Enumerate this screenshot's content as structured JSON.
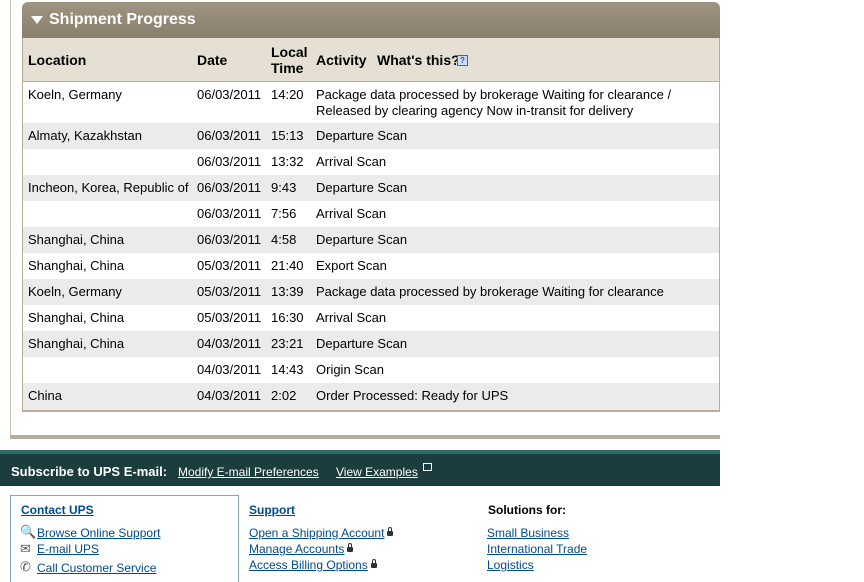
{
  "progress": {
    "title": "Shipment Progress",
    "columns": {
      "location": "Location",
      "date": "Date",
      "local": "Local",
      "time": "Time",
      "activity": "Activity",
      "whats_this": "What's this?"
    },
    "rows": [
      {
        "location": "Koeln, Germany",
        "date": "06/03/2011",
        "time": "14:20",
        "activity": "Package data processed by brokerage Waiting for clearance /",
        "activity2": "Released by clearing agency Now in-transit for delivery"
      },
      {
        "location": "Almaty, Kazakhstan",
        "date": "06/03/2011",
        "time": "15:13",
        "activity": "Departure Scan"
      },
      {
        "location": "",
        "date": "06/03/2011",
        "time": "13:32",
        "activity": "Arrival Scan"
      },
      {
        "location": "Incheon, Korea, Republic of",
        "date": "06/03/2011",
        "time": "9:43",
        "activity": "Departure Scan"
      },
      {
        "location": "",
        "date": "06/03/2011",
        "time": "7:56",
        "activity": "Arrival Scan"
      },
      {
        "location": "Shanghai, China",
        "date": "06/03/2011",
        "time": "4:58",
        "activity": "Departure Scan"
      },
      {
        "location": "Shanghai, China",
        "date": "05/03/2011",
        "time": "21:40",
        "activity": "Export Scan"
      },
      {
        "location": "Koeln, Germany",
        "date": "05/03/2011",
        "time": "13:39",
        "activity": "Package data processed by brokerage Waiting for clearance"
      },
      {
        "location": "Shanghai, China",
        "date": "05/03/2011",
        "time": "16:30",
        "activity": "Arrival Scan"
      },
      {
        "location": "Shanghai, China",
        "date": "04/03/2011",
        "time": "23:21",
        "activity": "Departure Scan"
      },
      {
        "location": "",
        "date": "04/03/2011",
        "time": "14:43",
        "activity": "Origin Scan"
      },
      {
        "location": "China",
        "date": "04/03/2011",
        "time": "2:02",
        "activity": "Order Processed: Ready for UPS"
      }
    ]
  },
  "subscribe": {
    "label": "Subscribe to UPS E-mail:",
    "modify": "Modify E-mail Preferences",
    "examples": "View Examples"
  },
  "footer": {
    "contact": {
      "title": "Contact UPS",
      "links": [
        "Browse Online Support",
        "E-mail UPS",
        "Call Customer Service"
      ]
    },
    "support": {
      "title": "Support",
      "links": [
        "Open a Shipping Account",
        "Manage Accounts",
        "Access Billing Options"
      ]
    },
    "solutions": {
      "title": "Solutions for:",
      "links": [
        "Small Business",
        "International Trade",
        "Logistics"
      ]
    }
  }
}
